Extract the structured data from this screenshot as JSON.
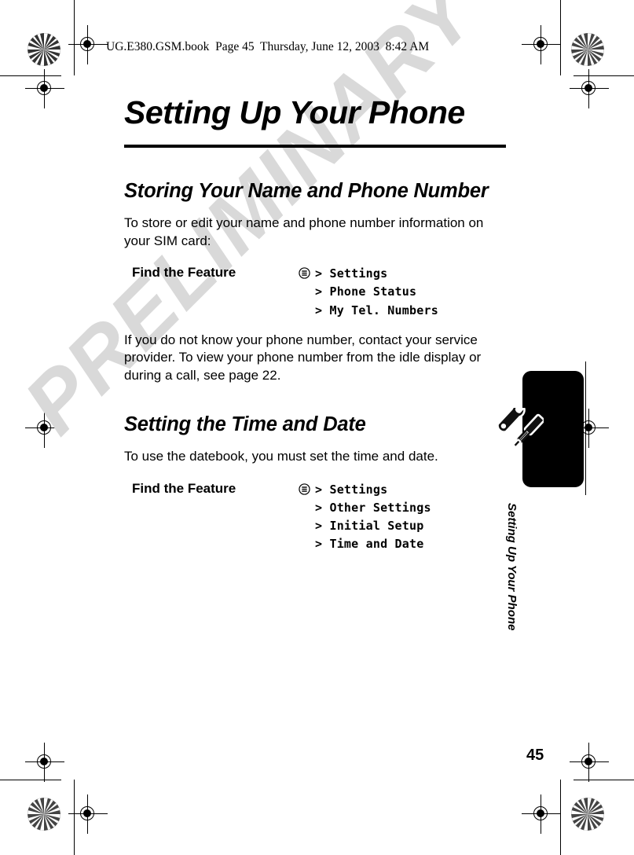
{
  "prepress": {
    "running_header": "UG.E380.GSM.book  Page 45  Thursday, June 12, 2003  8:42 AM",
    "watermark": "PRELIMINARY"
  },
  "page": {
    "chapter_title": "Setting Up Your Phone",
    "side_tab_title": "Setting Up Your Phone",
    "folio": "45"
  },
  "sections": [
    {
      "heading": "Storing Your Name and Phone Number",
      "intro": "To store or edit your name and phone number information on your SIM card:",
      "feature": {
        "label": "Find the Feature",
        "icon": "menu-icon",
        "path": [
          "> Settings",
          "> Phone Status",
          "> My Tel. Numbers"
        ]
      },
      "outro": "If you do not know your phone number, contact your service provider. To view your phone number from the idle display or during a call, see page 22."
    },
    {
      "heading": "Setting the Time and Date",
      "intro": "To use the datebook, you must set the time and date.",
      "feature": {
        "label": "Find the Feature",
        "icon": "menu-icon",
        "path": [
          "> Settings",
          "> Other Settings",
          "> Initial Setup",
          "> Time and Date"
        ]
      }
    }
  ],
  "colors": {
    "ink": "#000000",
    "watermark": "#d9d9d9",
    "paper": "#ffffff"
  }
}
